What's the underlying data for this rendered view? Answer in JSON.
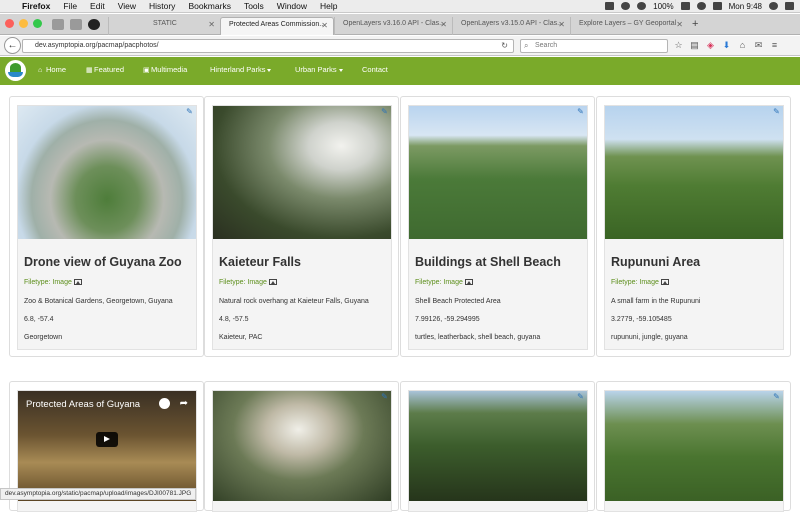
{
  "menubar": {
    "app": "Firefox",
    "items": [
      "File",
      "Edit",
      "View",
      "History",
      "Bookmarks",
      "Tools",
      "Window",
      "Help"
    ],
    "battery": "100%",
    "clock": "Mon 9:48"
  },
  "tabs": [
    {
      "label": "STATIC"
    },
    {
      "label": "Protected Areas Commission..."
    },
    {
      "label": "OpenLayers v3.16.0 API - Clas..."
    },
    {
      "label": "OpenLayers v3.15.0 API - Clas..."
    },
    {
      "label": "Explore Layers – GY Geoportal"
    }
  ],
  "toolbar": {
    "url": "dev.asymptopia.org/pacmap/pacphotos/",
    "search_placeholder": "Search"
  },
  "sitenav": {
    "items": [
      {
        "label": "Home",
        "icon": "home-icon"
      },
      {
        "label": "Featured",
        "icon": "film-icon"
      },
      {
        "label": "Multimedia",
        "icon": "picture-icon"
      },
      {
        "label": "Hinterland Parks",
        "dropdown": true
      },
      {
        "label": "Urban Parks",
        "dropdown": true
      },
      {
        "label": "Contact"
      }
    ]
  },
  "cards": [
    {
      "title": "Drone view of Guyana Zoo",
      "filetype": "Filetype: Image",
      "description": "Zoo & Botanical Gardens, Georgetown, Guyana",
      "coords": "6.8, -57.4",
      "tags": "Georgetown"
    },
    {
      "title": "Kaieteur Falls",
      "filetype": "Filetype: Image",
      "description": "Natural rock overhang at Kaieteur Falls, Guyana",
      "coords": "4.8, -57.5",
      "tags": "Kaieteur, PAC"
    },
    {
      "title": "Buildings at Shell Beach",
      "filetype": "Filetype: Image",
      "description": "Shell Beach Protected Area",
      "coords": "7.99126, -59.294995",
      "tags": "turtles, leatherback, shell beach, guyana"
    },
    {
      "title": "Rupununi Area",
      "filetype": "Filetype: Image",
      "description": "A small farm in the Rupununi",
      "coords": "3.2779, -59.105485",
      "tags": "rupununi, jungle, guyana"
    }
  ],
  "video_card": {
    "title": "Protected Areas of Guyana"
  },
  "statusbar": {
    "text": "dev.asymptopia.org/static/pacmap/upload/images/DJI00781.JPG"
  }
}
